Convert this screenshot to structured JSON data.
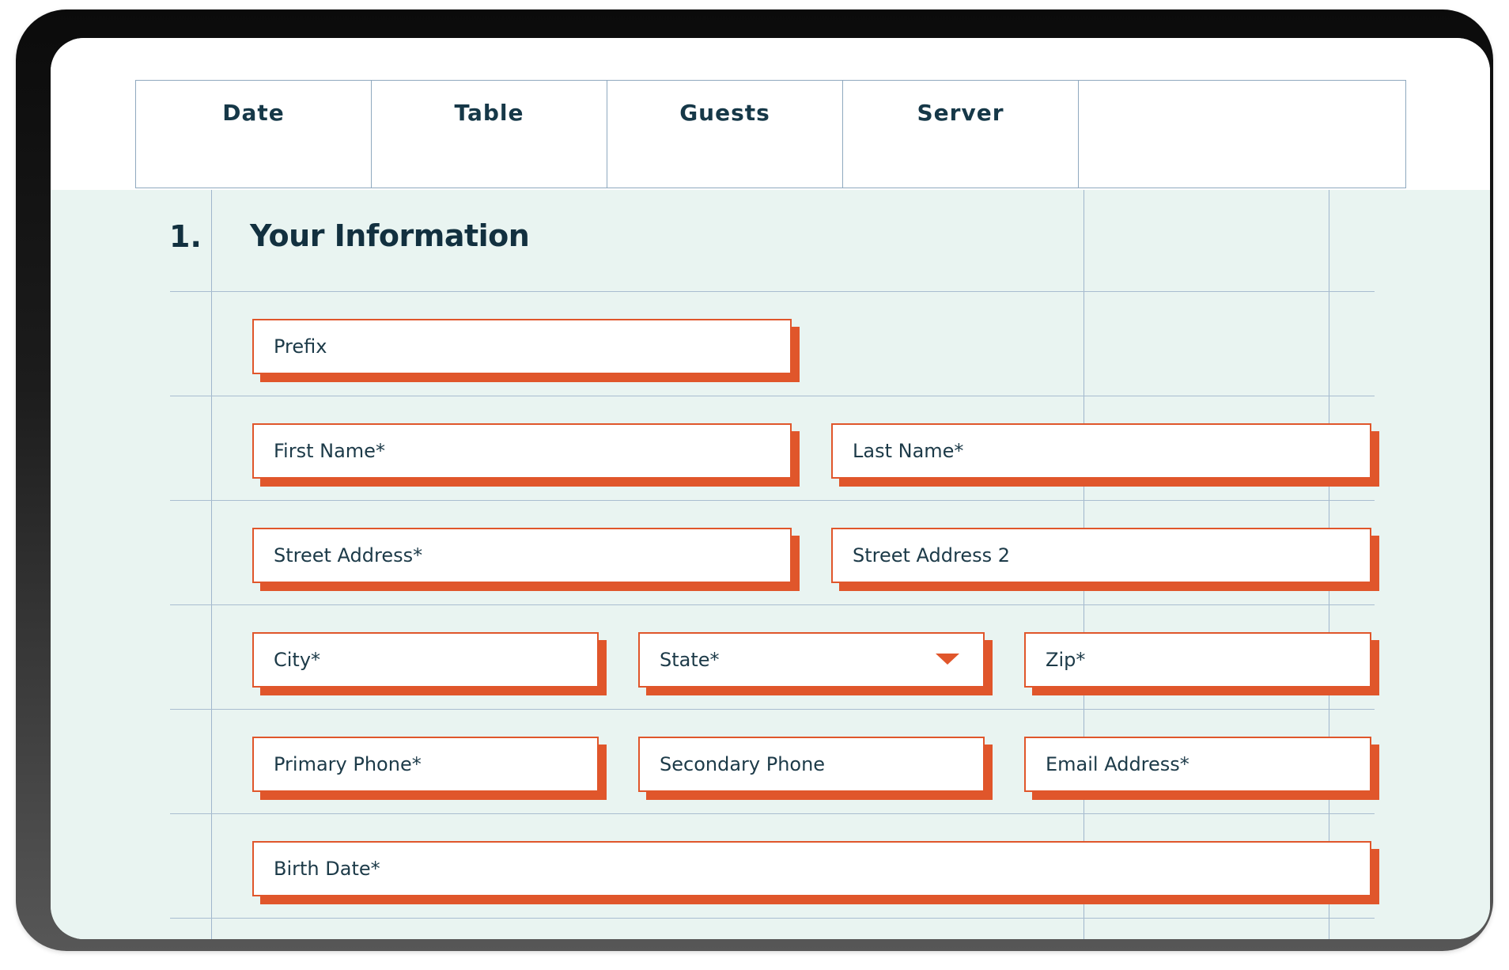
{
  "summary_table": {
    "headers": [
      "Date",
      "Table",
      "Guests",
      "Server",
      ""
    ]
  },
  "section": {
    "number": "1.",
    "title": "Your Information"
  },
  "fields": {
    "prefix": "Prefix",
    "first_name": "First Name*",
    "last_name": "Last Name*",
    "street_address": "Street Address*",
    "street_address_2": "Street Address 2",
    "city": "City*",
    "state": "State*",
    "zip": "Zip*",
    "primary_phone": "Primary Phone*",
    "secondary_phone": "Secondary Phone",
    "email": "Email Address*",
    "birth_date": "Birth Date*"
  },
  "icons": {
    "state_dropdown": "chevron-down-icon"
  },
  "colors": {
    "accent": "#e0562b",
    "text_dark": "#12303f",
    "form_bg": "#e9f4f1",
    "grid_line": "#9fb6cc"
  }
}
